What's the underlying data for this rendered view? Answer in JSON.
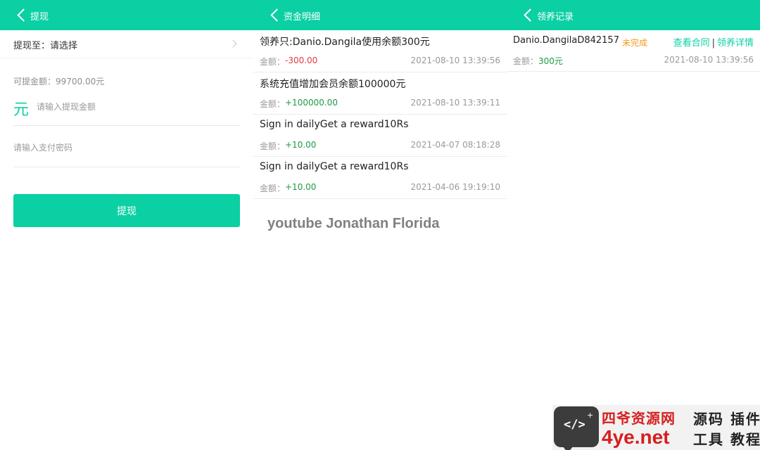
{
  "colors": {
    "brand": "#0bd0a3",
    "negative": "#e23b3b",
    "positive": "#1e9a45",
    "pending": "#f39c1f"
  },
  "withdraw": {
    "title": "提现",
    "to_label": "提现至：请选择",
    "available": "可提金额：99700.00元",
    "currency_symbol": "元",
    "amount_placeholder": "请输入提现金额",
    "password_placeholder": "请输入支付密码",
    "submit_label": "提现"
  },
  "funds": {
    "title": "资金明细",
    "amount_label": "金额：",
    "items": [
      {
        "desc": "领养只:Danio.Dangila使用余额300元",
        "amount": "-300.00",
        "time": "2021-08-10 13:39:56"
      },
      {
        "desc": "系统充值增加会员余额100000元",
        "amount": "+100000.00",
        "time": "2021-08-10 13:39:11"
      },
      {
        "desc": "Sign in dailyGet a reward10Rs",
        "amount": "+10.00",
        "time": "2021-04-07 08:18:28"
      },
      {
        "desc": "Sign in dailyGet a reward10Rs",
        "amount": "+10.00",
        "time": "2021-04-06 19:19:10"
      }
    ],
    "watermark": "youtube Jonathan Florida"
  },
  "adoption": {
    "title": "领养记录",
    "items": [
      {
        "name": "Danio.DangilaD842157",
        "status": "未完成",
        "link_contract": "查看合同",
        "separator": "|",
        "link_detail": "领养详情",
        "amount_label": "金额：",
        "amount": "300元",
        "time": "2021-08-10 13:39:56"
      }
    ]
  },
  "banner": {
    "logo_glyph": "</>",
    "logo_plus": "+",
    "brand_cn": "四爷资源网",
    "brand_en": "4ye.net",
    "tag_line1": "源码 插件",
    "tag_line2": "工具 教程"
  }
}
